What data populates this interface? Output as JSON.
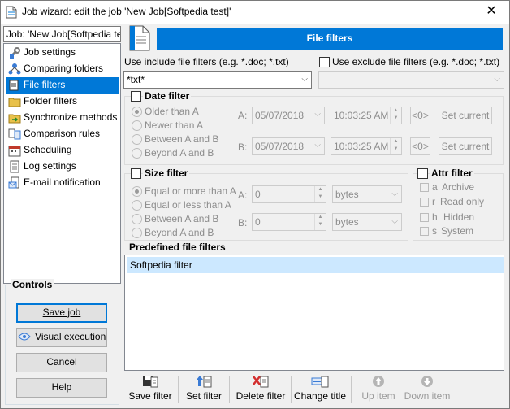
{
  "window": {
    "title": "Job wizard: edit the job 'New Job[Softpedia test]'"
  },
  "job_field": "Job: 'New Job[Softpedia test]'",
  "nav": [
    {
      "label": "Job settings",
      "icon": "wrench-icon"
    },
    {
      "label": "Comparing folders",
      "icon": "network-icon"
    },
    {
      "label": "File filters",
      "icon": "filter-icon",
      "selected": true
    },
    {
      "label": "Folder filters",
      "icon": "folder-icon"
    },
    {
      "label": "Synchronize methods",
      "icon": "sync-icon"
    },
    {
      "label": "Comparison rules",
      "icon": "rules-icon"
    },
    {
      "label": "Scheduling",
      "icon": "calendar-icon"
    },
    {
      "label": "Log settings",
      "icon": "log-icon"
    },
    {
      "label": "E-mail notification",
      "icon": "email-icon"
    }
  ],
  "controls": {
    "title": "Controls",
    "save_job": "Save job",
    "visual_execution": "Visual execution",
    "cancel": "Cancel",
    "help": "Help"
  },
  "header": {
    "title": "File filters"
  },
  "include": {
    "label": "Use include file filters (e.g. *.doc; *.txt)",
    "value": "*txt*"
  },
  "exclude": {
    "label": "Use exclude file filters (e.g. *.doc; *.txt)",
    "value": ""
  },
  "date_filter": {
    "title": "Date filter",
    "options": [
      "Older than A",
      "Newer than A",
      "Between A and B",
      "Beyond A and B"
    ],
    "a_label": "A:",
    "b_label": "B:",
    "a_date": "05/07/2018",
    "a_time": "10:03:25 AM",
    "b_date": "05/07/2018",
    "b_time": "10:03:25 AM",
    "zero_button": "<0>",
    "set_current": "Set current"
  },
  "size_filter": {
    "title": "Size filter",
    "options": [
      "Equal or more than A",
      "Equal or less than A",
      "Between A and B",
      "Beyond A and B"
    ],
    "a_label": "A:",
    "b_label": "B:",
    "a_value": "0",
    "b_value": "0",
    "unit": "bytes"
  },
  "attr_filter": {
    "title": "Attr filter",
    "items": [
      {
        "code": "a",
        "label": "Archive"
      },
      {
        "code": "r",
        "label": "Read only"
      },
      {
        "code": "h",
        "label": "Hidden"
      },
      {
        "code": "s",
        "label": "System"
      }
    ]
  },
  "predefined": {
    "title": "Predefined file filters",
    "items": [
      "Softpedia filter"
    ]
  },
  "toolbar": {
    "save_filter": "Save filter",
    "set_filter": "Set filter",
    "delete_filter": "Delete filter",
    "change_title": "Change title",
    "up_item": "Up item",
    "down_item": "Down item"
  },
  "colors": {
    "accent": "#0078d7",
    "selection": "#cce8ff"
  }
}
